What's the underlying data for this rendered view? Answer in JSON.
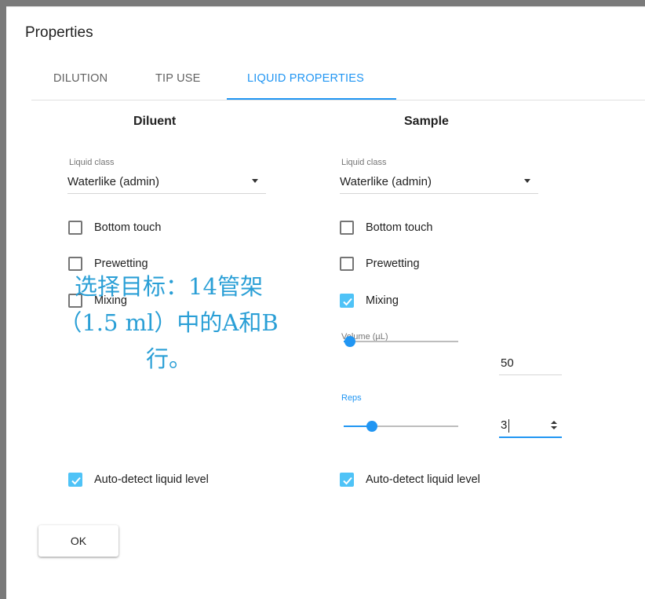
{
  "dialog": {
    "title": "Properties"
  },
  "tabs": [
    {
      "label": "DILUTION",
      "active": false
    },
    {
      "label": "TIP USE",
      "active": false
    },
    {
      "label": "LIQUID PROPERTIES",
      "active": true
    }
  ],
  "diluent": {
    "title": "Diluent",
    "liquid_class_label": "Liquid class",
    "liquid_class_value": "Waterlike (admin)",
    "bottom_touch": {
      "label": "Bottom touch",
      "checked": false
    },
    "prewetting": {
      "label": "Prewetting",
      "checked": false
    },
    "mixing": {
      "label": "Mixing",
      "checked": false
    },
    "auto_detect": {
      "label": "Auto-detect liquid level",
      "checked": true
    }
  },
  "sample": {
    "title": "Sample",
    "liquid_class_label": "Liquid class",
    "liquid_class_value": "Waterlike (admin)",
    "bottom_touch": {
      "label": "Bottom touch",
      "checked": false
    },
    "prewetting": {
      "label": "Prewetting",
      "checked": false
    },
    "mixing": {
      "label": "Mixing",
      "checked": true
    },
    "volume": {
      "label": "Volume (µL)",
      "value": "50",
      "slider_fraction": 0.0
    },
    "reps": {
      "label": "Reps",
      "value": "3",
      "slider_fraction": 0.2
    },
    "auto_detect": {
      "label": "Auto-detect liquid level",
      "checked": true
    }
  },
  "ok_label": "OK",
  "overlay_text": [
    "选择目标：14管架",
    "（1.5 ml）中的A和B",
    "行。"
  ],
  "colors": {
    "accent": "#2196f3",
    "checkbox_checked": "#4fc3f7",
    "overlay_text": "#2a9fd6"
  }
}
